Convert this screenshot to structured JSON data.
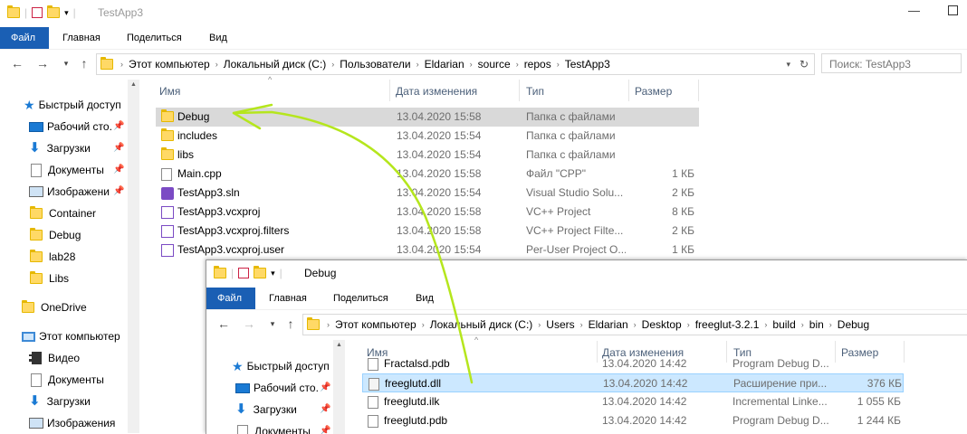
{
  "back_window": {
    "title": "TestApp3",
    "ribbon_tabs": [
      "Файл",
      "Главная",
      "Поделиться",
      "Вид"
    ],
    "breadcrumb": [
      "Этот компьютер",
      "Локальный диск (C:)",
      "Пользователи",
      "Eldarian",
      "source",
      "repos",
      "TestApp3"
    ],
    "search_placeholder": "Поиск: TestApp3",
    "columns": [
      "Имя",
      "Дата изменения",
      "Тип",
      "Размер"
    ],
    "nav": [
      {
        "label": "Быстрый доступ",
        "icon": "star-icon"
      },
      {
        "label": "Рабочий сто.",
        "icon": "desktop-icon",
        "pinned": true
      },
      {
        "label": "Загрузки",
        "icon": "download-icon",
        "pinned": true
      },
      {
        "label": "Документы",
        "icon": "documents-icon",
        "pinned": true
      },
      {
        "label": "Изображени",
        "icon": "pictures-icon",
        "pinned": true
      },
      {
        "label": "Container",
        "icon": "folder-icon"
      },
      {
        "label": "Debug",
        "icon": "folder-icon"
      },
      {
        "label": "lab28",
        "icon": "folder-icon"
      },
      {
        "label": "Libs",
        "icon": "folder-icon"
      },
      {
        "label": "OneDrive",
        "icon": "onedrive-icon"
      },
      {
        "label": "Этот компьютер",
        "icon": "computer-icon"
      },
      {
        "label": "Видео",
        "icon": "video-icon"
      },
      {
        "label": "Документы",
        "icon": "documents-icon"
      },
      {
        "label": "Загрузки",
        "icon": "download-icon"
      },
      {
        "label": "Изображения",
        "icon": "pictures-icon"
      }
    ],
    "files": [
      {
        "name": "Debug",
        "date": "13.04.2020 15:58",
        "type": "Папка с файлами",
        "size": "",
        "icon": "folder-icon",
        "selected": true
      },
      {
        "name": "includes",
        "date": "13.04.2020 15:54",
        "type": "Папка с файлами",
        "size": "",
        "icon": "folder-icon"
      },
      {
        "name": "libs",
        "date": "13.04.2020 15:54",
        "type": "Папка с файлами",
        "size": "",
        "icon": "folder-icon"
      },
      {
        "name": "Main.cpp",
        "date": "13.04.2020 15:58",
        "type": "Файл \"CPP\"",
        "size": "1 КБ",
        "icon": "cpp-file-icon"
      },
      {
        "name": "TestApp3.sln",
        "date": "13.04.2020 15:54",
        "type": "Visual Studio Solu...",
        "size": "2 КБ",
        "icon": "vs-solution-icon"
      },
      {
        "name": "TestApp3.vcxproj",
        "date": "13.04.2020 15:58",
        "type": "VC++ Project",
        "size": "8 КБ",
        "icon": "vcxproj-icon"
      },
      {
        "name": "TestApp3.vcxproj.filters",
        "date": "13.04.2020 15:58",
        "type": "VC++ Project Filte...",
        "size": "2 КБ",
        "icon": "vcxproj-icon"
      },
      {
        "name": "TestApp3.vcxproj.user",
        "date": "13.04.2020 15:54",
        "type": "Per-User Project O...",
        "size": "1 КБ",
        "icon": "vcxproj-user-icon"
      }
    ]
  },
  "front_window": {
    "title": "Debug",
    "ribbon_tabs": [
      "Файл",
      "Главная",
      "Поделиться",
      "Вид"
    ],
    "breadcrumb": [
      "Этот компьютер",
      "Локальный диск (C:)",
      "Users",
      "Eldarian",
      "Desktop",
      "freeglut-3.2.1",
      "build",
      "bin",
      "Debug"
    ],
    "columns": [
      "Имя",
      "Дата изменения",
      "Тип",
      "Размер"
    ],
    "nav": [
      {
        "label": "Быстрый доступ",
        "icon": "star-icon"
      },
      {
        "label": "Рабочий сто.",
        "icon": "desktop-icon",
        "pinned": true
      },
      {
        "label": "Загрузки",
        "icon": "download-icon",
        "pinned": true
      },
      {
        "label": "Документы",
        "icon": "documents-icon",
        "pinned": true
      }
    ],
    "files": [
      {
        "name": "Fractalsd.pdb",
        "date": "13.04.2020 14:42",
        "type": "Program Debug D...",
        "size": "",
        "icon": "pdb-file-icon",
        "partial": true
      },
      {
        "name": "freeglutd.dll",
        "date": "13.04.2020 14:42",
        "type": "Расширение при...",
        "size": "376 КБ",
        "icon": "dll-file-icon",
        "selected": true
      },
      {
        "name": "freeglutd.ilk",
        "date": "13.04.2020 14:42",
        "type": "Incremental Linke...",
        "size": "1 055 КБ",
        "icon": "ilk-file-icon"
      },
      {
        "name": "freeglutd.pdb",
        "date": "13.04.2020 14:42",
        "type": "Program Debug D...",
        "size": "1 244 КБ",
        "icon": "pdb-file-icon"
      }
    ]
  },
  "annotation": {
    "arrow_color": "#b5e61d"
  }
}
